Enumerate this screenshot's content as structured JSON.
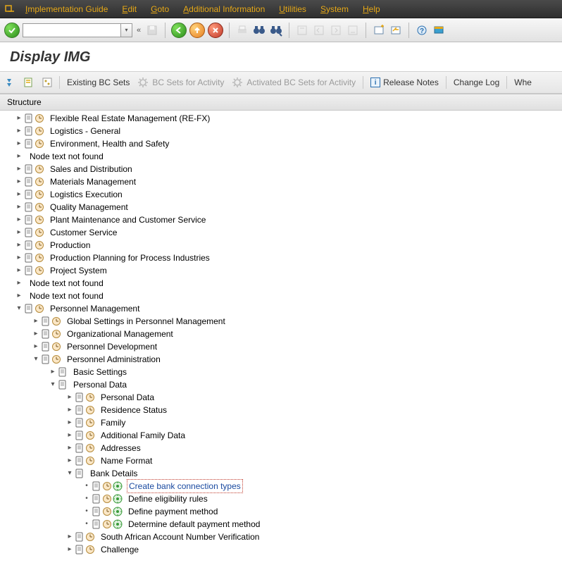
{
  "menubar": {
    "items": [
      {
        "label": "Implementation Guide",
        "ul": "I"
      },
      {
        "label": "Edit",
        "ul": "E"
      },
      {
        "label": "Goto",
        "ul": "G"
      },
      {
        "label": "Additional Information",
        "ul": "A"
      },
      {
        "label": "Utilities",
        "ul": "U"
      },
      {
        "label": "System",
        "ul": "S"
      },
      {
        "label": "Help",
        "ul": "H"
      }
    ]
  },
  "page_title": "Display IMG",
  "app_toolbar": {
    "existing_bc": "Existing BC Sets",
    "bc_activity": "BC Sets for Activity",
    "activated_bc": "Activated BC Sets for Activity",
    "release_notes": "Release Notes",
    "change_log": "Change Log",
    "where_used": "Whe"
  },
  "structure_title": "Structure",
  "tree": [
    {
      "level": 0,
      "exp": ">",
      "doc": true,
      "clock": true,
      "label": "Flexible Real Estate Management (RE-FX)"
    },
    {
      "level": 0,
      "exp": ">",
      "doc": true,
      "clock": true,
      "label": "Logistics - General"
    },
    {
      "level": 0,
      "exp": ">",
      "doc": true,
      "clock": true,
      "label": "Environment, Health and Safety"
    },
    {
      "level": 0,
      "exp": ">",
      "doc": false,
      "clock": false,
      "label": "Node text not found"
    },
    {
      "level": 0,
      "exp": ">",
      "doc": true,
      "clock": true,
      "label": "Sales and Distribution"
    },
    {
      "level": 0,
      "exp": ">",
      "doc": true,
      "clock": true,
      "label": "Materials Management"
    },
    {
      "level": 0,
      "exp": ">",
      "doc": true,
      "clock": true,
      "label": "Logistics Execution"
    },
    {
      "level": 0,
      "exp": ">",
      "doc": true,
      "clock": true,
      "label": "Quality Management"
    },
    {
      "level": 0,
      "exp": ">",
      "doc": true,
      "clock": true,
      "label": "Plant Maintenance and Customer Service"
    },
    {
      "level": 0,
      "exp": ">",
      "doc": true,
      "clock": true,
      "label": "Customer Service"
    },
    {
      "level": 0,
      "exp": ">",
      "doc": true,
      "clock": true,
      "label": "Production"
    },
    {
      "level": 0,
      "exp": ">",
      "doc": true,
      "clock": true,
      "label": "Production Planning for Process Industries"
    },
    {
      "level": 0,
      "exp": ">",
      "doc": true,
      "clock": true,
      "label": "Project System"
    },
    {
      "level": 0,
      "exp": ">",
      "doc": false,
      "clock": false,
      "label": "Node text not found"
    },
    {
      "level": 0,
      "exp": ">",
      "doc": false,
      "clock": false,
      "label": "Node text not found"
    },
    {
      "level": 0,
      "exp": "v",
      "doc": true,
      "clock": true,
      "label": "Personnel Management"
    },
    {
      "level": 1,
      "exp": ">",
      "doc": true,
      "clock": true,
      "label": "Global Settings in Personnel Management"
    },
    {
      "level": 1,
      "exp": ">",
      "doc": true,
      "clock": true,
      "label": "Organizational Management"
    },
    {
      "level": 1,
      "exp": ">",
      "doc": true,
      "clock": true,
      "label": "Personnel Development"
    },
    {
      "level": 1,
      "exp": "v",
      "doc": true,
      "clock": true,
      "label": "Personnel Administration"
    },
    {
      "level": 2,
      "exp": ">",
      "doc": true,
      "clock": false,
      "label": "Basic Settings"
    },
    {
      "level": 2,
      "exp": "v",
      "doc": true,
      "clock": false,
      "label": "Personal Data"
    },
    {
      "level": 3,
      "exp": ">",
      "doc": true,
      "clock": true,
      "label": "Personal Data"
    },
    {
      "level": 3,
      "exp": ">",
      "doc": true,
      "clock": true,
      "label": "Residence Status"
    },
    {
      "level": 3,
      "exp": ">",
      "doc": true,
      "clock": true,
      "label": "Family"
    },
    {
      "level": 3,
      "exp": ">",
      "doc": true,
      "clock": true,
      "label": "Additional Family Data"
    },
    {
      "level": 3,
      "exp": ">",
      "doc": true,
      "clock": true,
      "label": "Addresses"
    },
    {
      "level": 3,
      "exp": ">",
      "doc": true,
      "clock": true,
      "label": "Name Format"
    },
    {
      "level": 3,
      "exp": "v",
      "doc": true,
      "clock": false,
      "label": "Bank Details"
    },
    {
      "level": 4,
      "exp": "·",
      "doc": true,
      "clock": true,
      "exec": true,
      "label": "Create bank connection types",
      "selected": true
    },
    {
      "level": 4,
      "exp": "·",
      "doc": true,
      "clock": true,
      "exec": true,
      "label": "Define eligibility rules"
    },
    {
      "level": 4,
      "exp": "·",
      "doc": true,
      "clock": true,
      "exec": true,
      "label": "Define payment method"
    },
    {
      "level": 4,
      "exp": "·",
      "doc": true,
      "clock": true,
      "exec": true,
      "label": "Determine default payment method"
    },
    {
      "level": 3,
      "exp": ">",
      "doc": true,
      "clock": true,
      "label": "South African Account Number Verification"
    },
    {
      "level": 3,
      "exp": ">",
      "doc": true,
      "clock": true,
      "label": "Challenge"
    }
  ]
}
